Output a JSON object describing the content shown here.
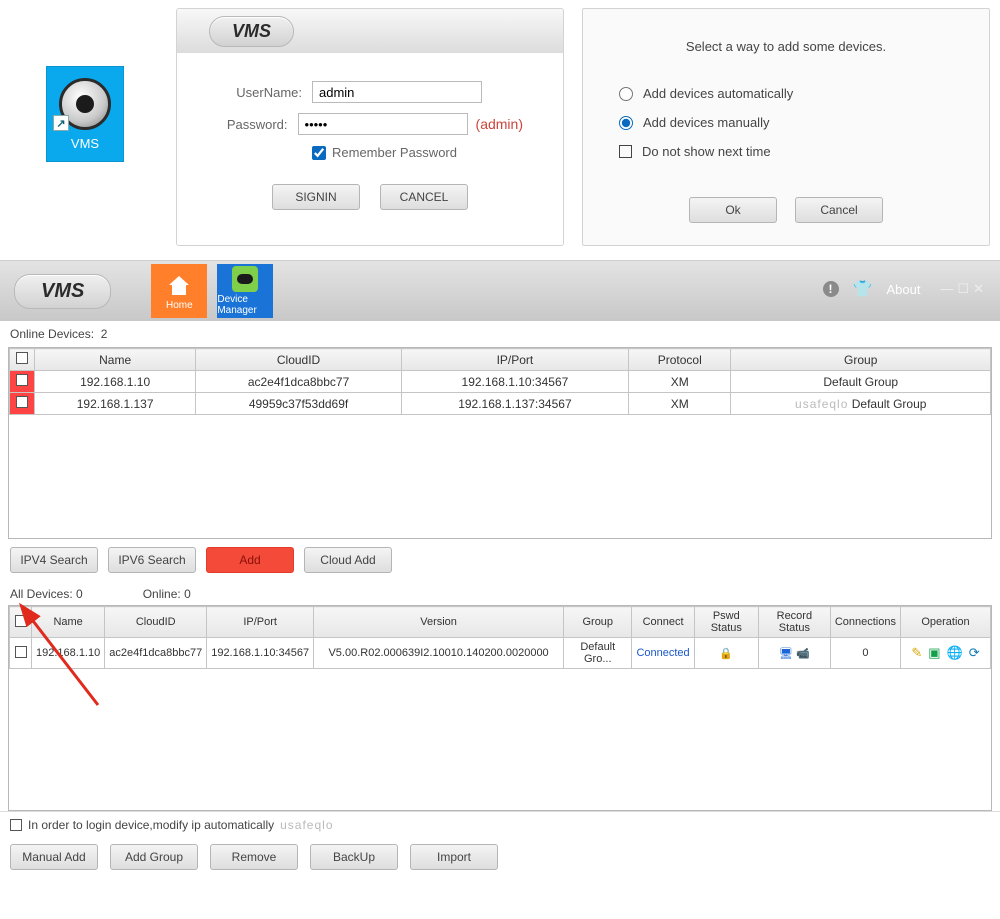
{
  "appName": "VMS",
  "desktopIcon": {
    "label": "VMS"
  },
  "login": {
    "userLabel": "UserName:",
    "passLabel": "Password:",
    "userValue": "admin",
    "passValue": "•••••",
    "passHint": "(admin)",
    "rememberLabel": "Remember Password",
    "rememberChecked": true,
    "signin": "SIGNIN",
    "cancel": "CANCEL"
  },
  "wizard": {
    "title": "Select a way to add some devices.",
    "options": {
      "auto": "Add devices automatically",
      "manual": "Add devices manually",
      "noshow": "Do not show next time"
    },
    "selected": "manual",
    "ok": "Ok",
    "cancel": "Cancel"
  },
  "main": {
    "brand": "VMS",
    "tiles": {
      "home": "Home",
      "devmgr": "Device Manager"
    },
    "about": "About",
    "onlineDevicesLabel": "Online Devices:",
    "onlineDevicesCount": "2",
    "table1": {
      "headers": [
        "Name",
        "CloudID",
        "IP/Port",
        "Protocol",
        "Group"
      ],
      "rows": [
        {
          "name": "192.168.1.10",
          "cloud": "ac2e4f1dca8bbc77",
          "ipport": "192.168.1.10:34567",
          "proto": "XM",
          "group": "Default Group"
        },
        {
          "name": "192.168.1.137",
          "cloud": "49959c37f53dd69f",
          "ipport": "192.168.1.137:34567",
          "proto": "XM",
          "group": "Default Group",
          "wm": "usafeqlo"
        }
      ]
    },
    "btns1": {
      "ipv4": "IPV4 Search",
      "ipv6": "IPV6 Search",
      "add": "Add",
      "cloud": "Cloud Add"
    },
    "summary": {
      "allLabel": "All Devices:",
      "allCount": "0",
      "onlineLabel": "Online:",
      "onlineCount": "0"
    },
    "table2": {
      "headers": [
        "Name",
        "CloudID",
        "IP/Port",
        "Version",
        "Group",
        "Connect",
        "Pswd Status",
        "Record Status",
        "Connections",
        "Operation"
      ],
      "row": {
        "name": "192.168.1.10",
        "cloud": "ac2e4f1dca8bbc77",
        "ipport": "192.168.1.10:34567",
        "version": "V5.00.R02.000639I2.10010.140200.0020000",
        "group": "Default Gro...",
        "connect": "Connected",
        "connections": "0"
      }
    },
    "footerNote": "In order to login device,modify ip automatically",
    "footerWM": "usafeqlo",
    "footerBtns": {
      "manual": "Manual Add",
      "group": "Add Group",
      "remove": "Remove",
      "backup": "BackUp",
      "import": "Import"
    }
  }
}
